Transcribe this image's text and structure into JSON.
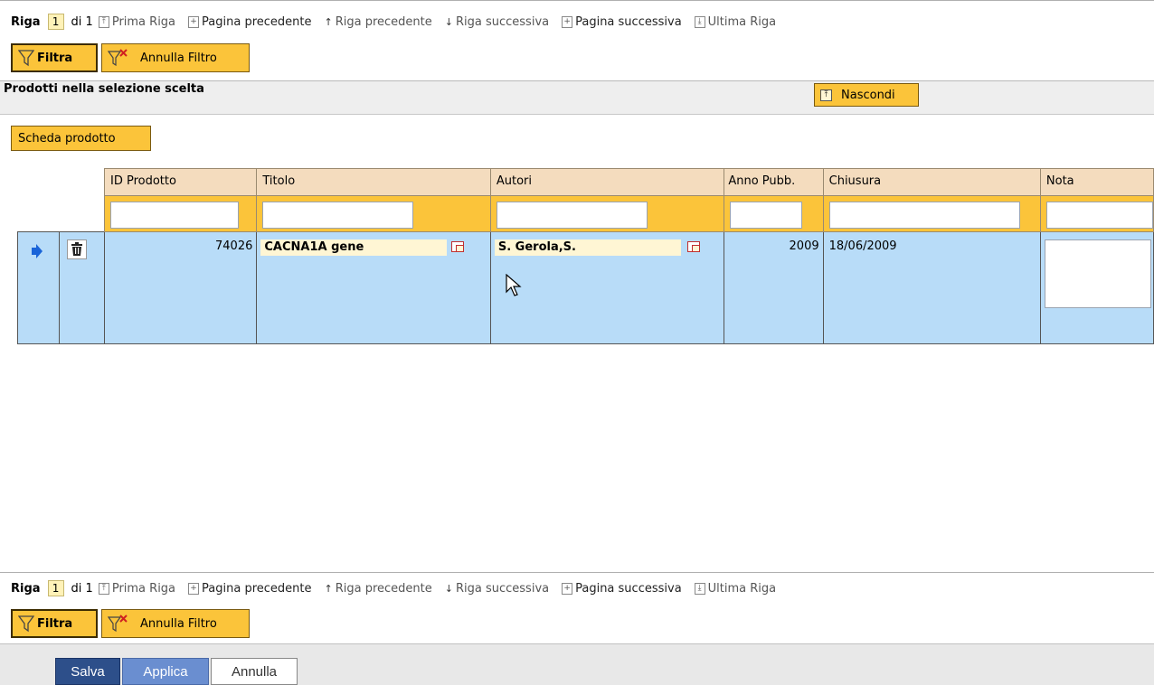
{
  "nav": {
    "riga_label": "Riga",
    "page": "1",
    "of_text": "di 1",
    "first": "Prima Riga",
    "prev_page": "Pagina precedente",
    "prev_row": "Riga precedente",
    "next_row": "Riga successiva",
    "next_page": "Pagina successiva",
    "last": "Ultima Riga"
  },
  "filter": {
    "filtra": "Filtra",
    "annulla": "Annulla Filtro"
  },
  "panel": {
    "title": "Prodotti nella selezione scelta",
    "hide": "Nascondi",
    "scheda": "Scheda prodotto"
  },
  "grid": {
    "headers": [
      "ID Prodotto",
      "Titolo",
      "Autori",
      "Anno Pubb.",
      "Chiusura",
      "Nota"
    ],
    "row": {
      "id": "74026",
      "titolo": "CACNA1A gene",
      "autori": "S. Gerola,S.",
      "anno": "2009",
      "chiusura": "18/06/2009",
      "nota": ""
    }
  },
  "footer": {
    "salva": "Salva",
    "applica": "Applica",
    "annulla": "Annulla"
  },
  "colors": {
    "orange": "#fbc43a",
    "row_blue": "#b8dcf8",
    "header_beige": "#f4dcbe",
    "button_navy": "#2d4f8a"
  }
}
